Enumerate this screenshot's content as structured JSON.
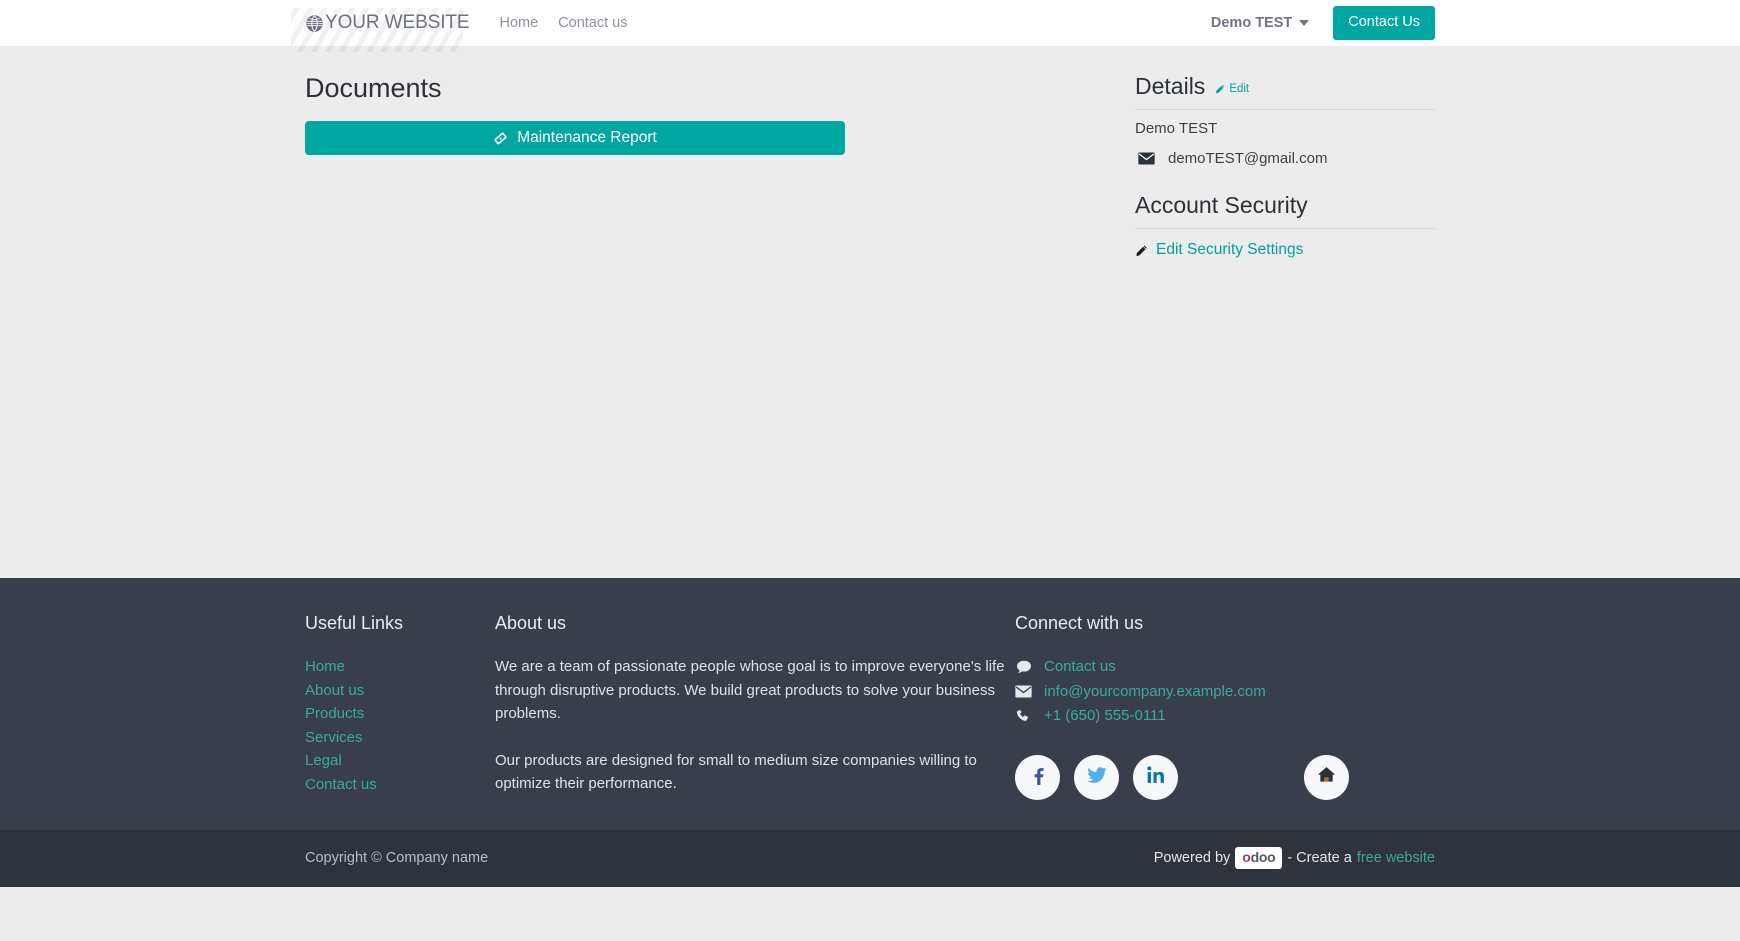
{
  "colors": {
    "accent_teal": "#00a7a0",
    "link_teal": "#00a09d",
    "footer_bg": "#383f4a",
    "copybar_bg": "#2e333c",
    "page_bg": "#ececec",
    "footer_link": "#3aa99f"
  },
  "header": {
    "brand_name": "YOUR WEBSITE",
    "brand_icon": "globe-icon",
    "nav": [
      {
        "label": "Home"
      },
      {
        "label": "Contact us"
      }
    ],
    "user_menu_label": "Demo TEST",
    "user_menu_icon": "chevron-down-icon",
    "contact_button_label": "Contact Us"
  },
  "main": {
    "page_title": "Documents",
    "documents": [
      {
        "label": "Maintenance Report",
        "icon": "certificate-icon"
      }
    ]
  },
  "sidebar": {
    "details_title": "Details",
    "details_edit_label": "Edit",
    "details_edit_icon": "pencil-icon",
    "user_name": "Demo TEST",
    "email_icon": "envelope-icon",
    "email": "demoTEST@gmail.com",
    "security_title": "Account Security",
    "security_link_label": "Edit Security Settings",
    "security_link_icon": "pencil-icon"
  },
  "footer": {
    "useful_links": {
      "heading": "Useful Links",
      "links": [
        {
          "label": "Home"
        },
        {
          "label": "About us"
        },
        {
          "label": "Products"
        },
        {
          "label": "Services"
        },
        {
          "label": "Legal"
        },
        {
          "label": "Contact us"
        }
      ]
    },
    "about": {
      "heading": "About us",
      "paragraph1": "We are a team of passionate people whose goal is to improve everyone's life through disruptive products. We build great products to solve your business problems.",
      "paragraph2": "Our products are designed for small to medium size companies willing to optimize their performance."
    },
    "connect": {
      "heading": "Connect with us",
      "contact_icon": "comment-icon",
      "contact_label": "Contact us",
      "email_icon": "envelope-icon",
      "email": "info@yourcompany.example.com",
      "phone_icon": "phone-icon",
      "phone": "+1 (650) 555-0111",
      "socials": [
        {
          "name": "facebook-icon",
          "label": "f"
        },
        {
          "name": "twitter-icon",
          "label": ""
        },
        {
          "name": "linkedin-icon",
          "label": "in"
        }
      ],
      "home_button_icon": "home-icon"
    }
  },
  "copyright": {
    "left_text": "Copyright © Company name",
    "powered_by": "Powered by",
    "odoo_o": "o",
    "odoo_doo": "doo",
    "create_a": "- Create a",
    "free_website": "free website"
  }
}
